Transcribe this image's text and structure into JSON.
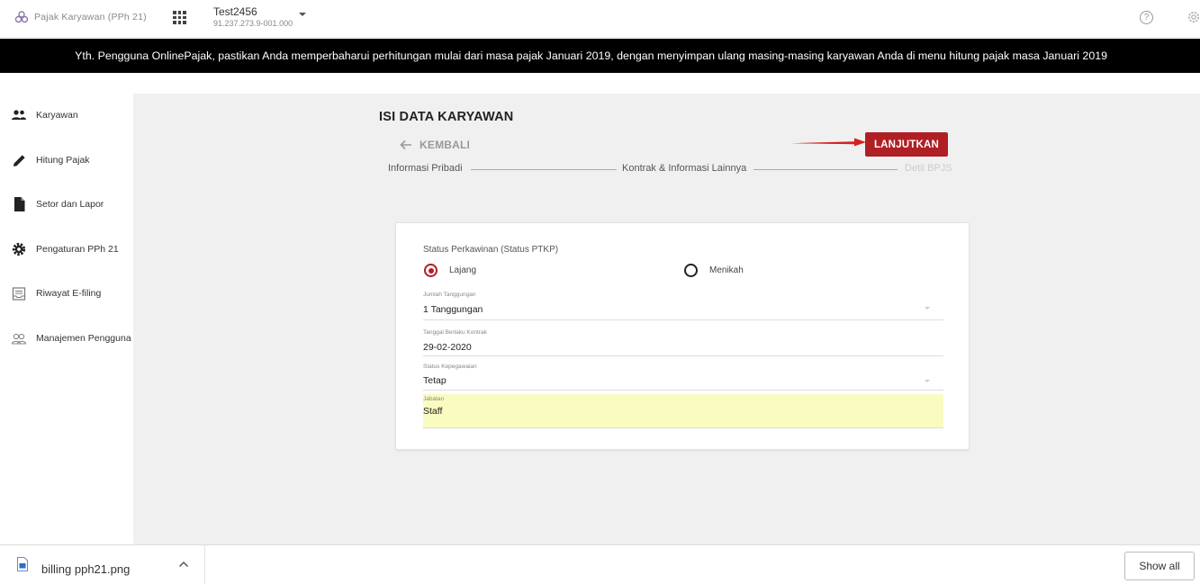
{
  "header": {
    "brand_name": "Pajak Karyawan (PPh 21)",
    "account_name": "Test2456",
    "account_npwp": "91.237.273.9-001.000"
  },
  "banner": {
    "text": "Yth. Pengguna OnlinePajak, pastikan Anda memperbaharui perhitungan mulai dari masa pajak Januari 2019, dengan menyimpan ulang masing-masing karyawan Anda di menu hitung pajak masa Januari 2019"
  },
  "sidebar": {
    "items": [
      {
        "label": "Karyawan",
        "icon": "people-icon"
      },
      {
        "label": "Hitung Pajak",
        "icon": "pencil-icon"
      },
      {
        "label": "Setor dan Lapor",
        "icon": "document-icon"
      },
      {
        "label": "Pengaturan PPh 21",
        "icon": "gear-icon"
      },
      {
        "label": "Riwayat E-filing",
        "icon": "inbox-icon"
      },
      {
        "label": "Manajemen Pengguna",
        "icon": "users-manage-icon"
      }
    ]
  },
  "main": {
    "title": "ISI DATA KARYAWAN",
    "back_label": "KEMBALI",
    "next_label": "LANJUTKAN",
    "steps": [
      "Informasi Pribadi",
      "Kontrak & Informasi Lainnya",
      "Detil BPJS"
    ],
    "form": {
      "status_title": "Status Perkawinan (Status PTKP)",
      "radio_single": "Lajang",
      "radio_married": "Menikah",
      "selected_status": "Lajang",
      "dependents_label": "Jumlah Tanggungan",
      "dependents_value": "1 Tanggungan",
      "contract_date_label": "Tanggal Berlaku Kontrak",
      "contract_date_value": "29-02-2020",
      "employment_label": "Status Kepegawaian",
      "employment_value": "Tetap",
      "position_label": "Jabatan",
      "position_value": "Staff"
    }
  },
  "download_bar": {
    "file_name": "billing pph21.png",
    "show_all_label": "Show all"
  },
  "colors": {
    "accent": "#b01f24",
    "banner_bg": "#000000",
    "main_bg": "#f0f0f0",
    "highlight_field": "#f9fbc0"
  }
}
